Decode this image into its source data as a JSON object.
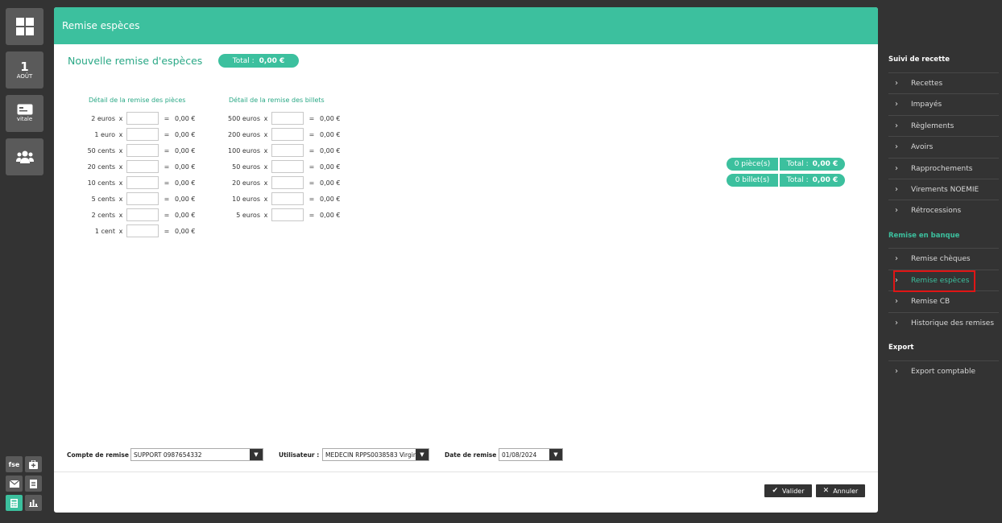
{
  "left_rail": {
    "calendar": {
      "day": "1",
      "month": "AOÛT"
    },
    "vitale_label": "vitale",
    "fse_label": "fse"
  },
  "panel": {
    "header_title": "Remise espèces",
    "page_title": "Nouvelle remise d'espèces",
    "total_label": "Total :",
    "total_value": "0,00 €"
  },
  "coins": {
    "title": "Détail de la remise des pièces",
    "rows": [
      {
        "label": "2 euros",
        "x": "x",
        "eq": "=",
        "value": "0,00 €"
      },
      {
        "label": "1 euro",
        "x": "x",
        "eq": "=",
        "value": "0,00 €"
      },
      {
        "label": "50 cents",
        "x": "x",
        "eq": "=",
        "value": "0,00 €"
      },
      {
        "label": "20 cents",
        "x": "x",
        "eq": "=",
        "value": "0,00 €"
      },
      {
        "label": "10 cents",
        "x": "x",
        "eq": "=",
        "value": "0,00 €"
      },
      {
        "label": "5 cents",
        "x": "x",
        "eq": "=",
        "value": "0,00 €"
      },
      {
        "label": "2 cents",
        "x": "x",
        "eq": "=",
        "value": "0,00 €"
      },
      {
        "label": "1 cent",
        "x": "x",
        "eq": "=",
        "value": "0,00 €"
      }
    ]
  },
  "notes": {
    "title": "Détail de la remise des billets",
    "rows": [
      {
        "label": "500 euros",
        "x": "x",
        "eq": "=",
        "value": "0,00 €"
      },
      {
        "label": "200 euros",
        "x": "x",
        "eq": "=",
        "value": "0,00 €"
      },
      {
        "label": "100 euros",
        "x": "x",
        "eq": "=",
        "value": "0,00 €"
      },
      {
        "label": "50 euros",
        "x": "x",
        "eq": "=",
        "value": "0,00 €"
      },
      {
        "label": "20 euros",
        "x": "x",
        "eq": "=",
        "value": "0,00 €"
      },
      {
        "label": "10 euros",
        "x": "x",
        "eq": "=",
        "value": "0,00 €"
      },
      {
        "label": "5 euros",
        "x": "x",
        "eq": "=",
        "value": "0,00 €"
      }
    ]
  },
  "summary": {
    "coins": {
      "count": "0 pièce(s)",
      "total_label": "Total :",
      "total_value": "0,00 €"
    },
    "notes": {
      "count": "0 billet(s)",
      "total_label": "Total :",
      "total_value": "0,00 €"
    }
  },
  "footer": {
    "account_label": "Compte de remise :",
    "account_value": "SUPPORT 0987654332",
    "user_label": "Utilisateur :",
    "user_value": "MEDECIN RPPS0038583 Virginie",
    "date_label": "Date de remise :",
    "date_value": "01/08/2024",
    "validate_label": "Valider",
    "cancel_label": "Annuler"
  },
  "sidebar": {
    "sections": [
      {
        "title": "Suivi de recette",
        "items": [
          "Recettes",
          "Impayés",
          "Règlements",
          "Avoirs",
          "Rapprochements",
          "Virements NOEMIE",
          "Rétrocessions"
        ]
      },
      {
        "title": "Remise en banque",
        "items": [
          "Remise chèques",
          "Remise espèces",
          "Remise CB",
          "Historique des remises"
        ]
      },
      {
        "title": "Export",
        "items": [
          "Export comptable"
        ]
      }
    ],
    "active_item": "Remise espèces"
  },
  "colors": {
    "accent": "#3cc09e",
    "background": "#333333",
    "highlight": "#e01515"
  }
}
